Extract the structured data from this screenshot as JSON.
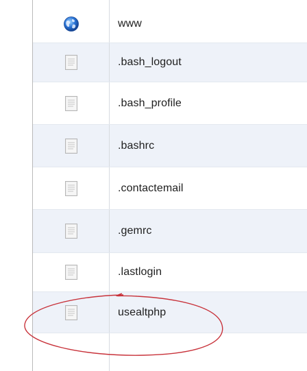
{
  "file_list": {
    "rows": [
      {
        "name": "www",
        "icon": "globe-icon"
      },
      {
        "name": ".bash_logout",
        "icon": "file-icon"
      },
      {
        "name": ".bash_profile",
        "icon": "file-icon"
      },
      {
        "name": ".bashrc",
        "icon": "file-icon"
      },
      {
        "name": ".contactemail",
        "icon": "file-icon"
      },
      {
        "name": ".gemrc",
        "icon": "file-icon"
      },
      {
        "name": ".lastlogin",
        "icon": "file-icon"
      },
      {
        "name": "usealtphp",
        "icon": "file-icon"
      }
    ]
  },
  "annotation": {
    "highlighted_file": "usealtphp",
    "color": "#c8323a"
  },
  "colors": {
    "row_alt": "#eef2f9",
    "row_plain": "#ffffff",
    "divider": "#d7dbe0",
    "text": "#1e1e1e"
  }
}
